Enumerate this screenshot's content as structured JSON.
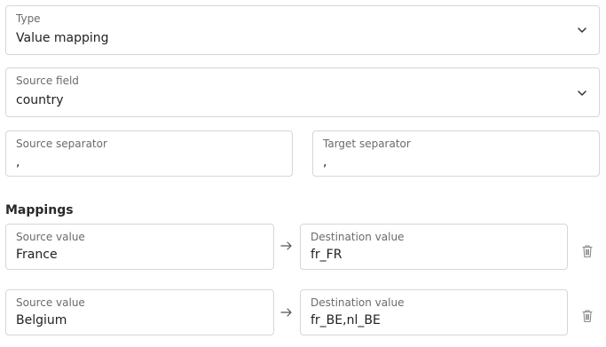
{
  "type_field": {
    "label": "Type",
    "value": "Value mapping"
  },
  "source_field": {
    "label": "Source field",
    "value": "country"
  },
  "source_separator": {
    "label": "Source separator",
    "value": ","
  },
  "target_separator": {
    "label": "Target separator",
    "value": ","
  },
  "mappings": {
    "title": "Mappings",
    "rows": [
      {
        "source_label": "Source value",
        "source_value": "France",
        "dest_label": "Destination value",
        "dest_value": "fr_FR"
      },
      {
        "source_label": "Source value",
        "source_value": "Belgium",
        "dest_label": "Destination value",
        "dest_value": "fr_BE,nl_BE"
      }
    ]
  },
  "icons": {
    "dropdown": "chevron-down-icon",
    "arrow": "arrow-right-icon",
    "delete": "trash-icon"
  },
  "colors": {
    "border": "#d6d6d6",
    "label": "#6b6b6b",
    "text": "#1f1f1f",
    "icon": "#8a8a8a"
  }
}
